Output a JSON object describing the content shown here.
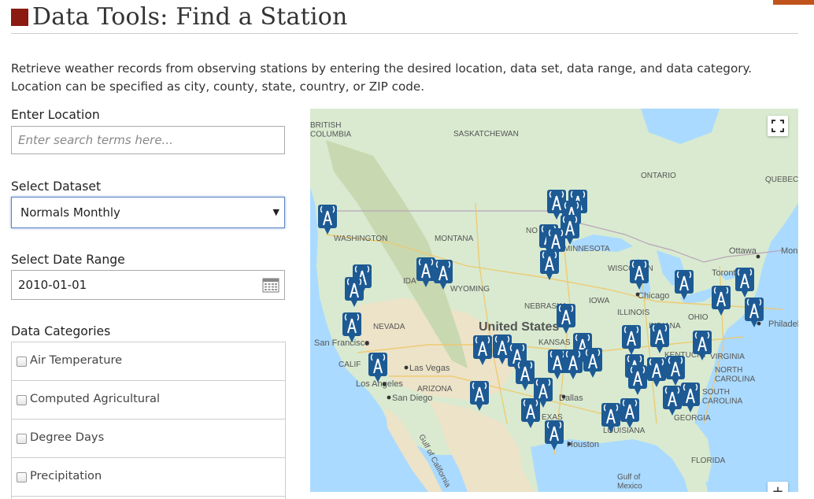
{
  "page": {
    "title": "Data Tools: Find a Station",
    "intro": "Retrieve weather records from observing stations by entering the desired location, data set, data range, and data category. Location can be specified as city, county, state, country, or ZIP code."
  },
  "form": {
    "location_label": "Enter Location",
    "location_placeholder": "Enter search terms here...",
    "dataset_label": "Select Dataset",
    "dataset_value": "Normals Monthly",
    "date_label": "Select Date Range",
    "date_value": "2010-01-01",
    "categories_label": "Data Categories",
    "categories": [
      "Air Temperature",
      "Computed Agricultural",
      "Degree Days",
      "Precipitation"
    ]
  },
  "map": {
    "labels": {
      "british_columbia": "BRITISH\nCOLUMBIA",
      "saskatchewan": "SASKATCHEWAN",
      "ontario": "ONTARIO",
      "quebec": "QUEBEC",
      "washington": "WASHINGTON",
      "montana": "MONTANA",
      "north_dakota": "NO",
      "minnesota": "MINNESOTA",
      "ottawa": "Ottawa",
      "montreal": "Mon",
      "toronto": "Toront",
      "idaho": "IDA",
      "wyoming": "WYOMING",
      "wisconsin": "WISCONSIN",
      "nebraska": "NEBRASKA",
      "iowa": "IOWA",
      "chicago": "Chicago",
      "nevada": "NEVADA",
      "illinois": "ILLINOIS",
      "indiana": "INDIANA",
      "ohio": "OHIO",
      "philadelphia": "Philadel",
      "united_states": "United States",
      "san_francisco": "San Francisco",
      "kansas": "KANSAS",
      "california": "CALIF",
      "las_vegas": "Las Vegas",
      "kentucky": "KENTUCKY",
      "virginia": "VIRGINIA",
      "los_angeles": "Los Angeles",
      "arizona": "ARIZONA",
      "north_carolina": "NORTH\nCAROLINA",
      "san_diego": "San Diego",
      "dallas": "Dallas",
      "south_carolina": "SOUTH\nCAROLINA",
      "texas": "EXAS",
      "louisiana": "LOUISIANA",
      "georgia": "GEORGIA",
      "houston": "Houston",
      "florida": "FLORIDA",
      "gulf_of_california": "Gulf of California",
      "gulf_of_mexico": "Gulf of\nMexico"
    },
    "zoom_in_label": "+"
  },
  "colors": {
    "title_square": "#8b1a10",
    "accent_tab": "#c0531c",
    "marker": "#1d5a94",
    "water": "#aadaff",
    "land": "#d9ead0",
    "mountain": "#c8d8b0",
    "desert": "#ece3c8"
  },
  "icons": {
    "fullscreen": "fullscreen-icon",
    "calendar": "calendar-icon",
    "marker": "weather-station-marker-icon"
  }
}
